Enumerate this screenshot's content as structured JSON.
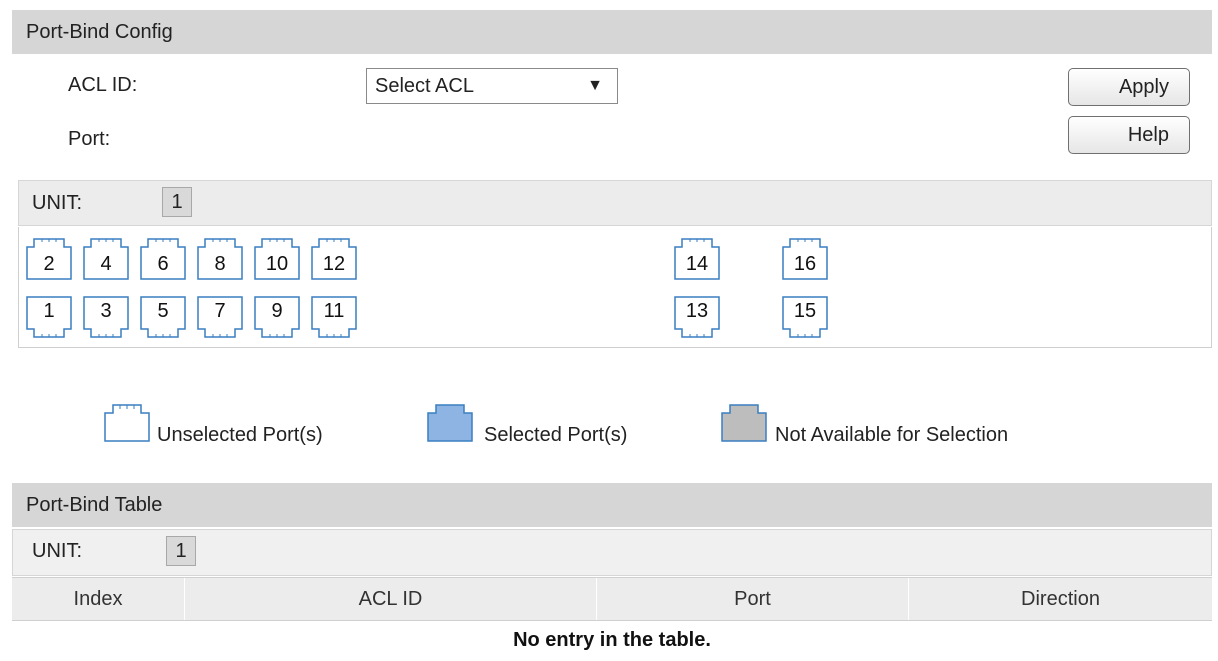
{
  "config": {
    "title": "Port-Bind Config",
    "acl_label": "ACL ID:",
    "acl_select_value": "Select ACL",
    "port_label": "Port:",
    "apply_label": "Apply",
    "help_label": "Help"
  },
  "unit_selector": {
    "label": "UNIT:",
    "value": "1"
  },
  "ports": {
    "top_row": [
      "2",
      "4",
      "6",
      "8",
      "10",
      "12",
      "14",
      "16"
    ],
    "bottom_row": [
      "1",
      "3",
      "5",
      "7",
      "9",
      "11",
      "13",
      "15"
    ]
  },
  "legend": {
    "unselected": "Unselected Port(s)",
    "selected": "Selected Port(s)",
    "unavailable": "Not Available for Selection"
  },
  "table": {
    "title": "Port-Bind Table",
    "unit_label": "UNIT:",
    "unit_value": "1",
    "columns": [
      "Index",
      "ACL ID",
      "Port",
      "Direction"
    ],
    "empty_message": "No entry in the table."
  },
  "colors": {
    "header_bg": "#d6d6d6",
    "port_outline": "#3a7fc1",
    "selected_fill": "#8db4e2",
    "unavailable_fill": "#bdbdbd"
  }
}
